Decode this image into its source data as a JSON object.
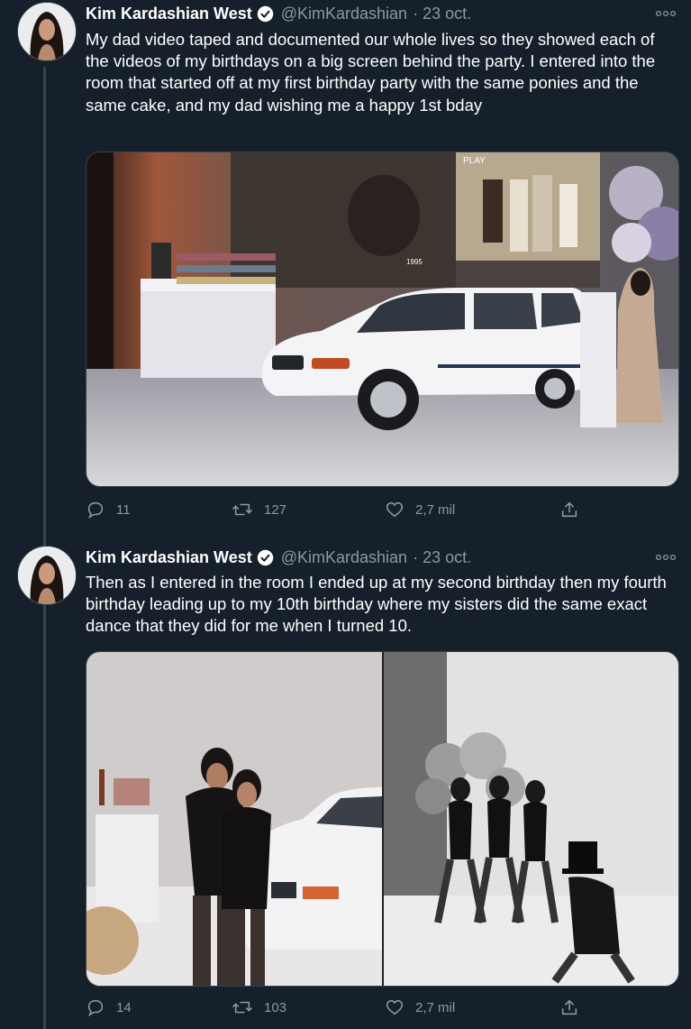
{
  "tweets": [
    {
      "author": {
        "name": "Kim Kardashian West",
        "handle": "@KimKardashian",
        "date": "· 23 oct."
      },
      "text": "My dad video taped and documented our whole lives so they showed each of the videos of my birthdays on a big screen behind the party. I entered into the room that started off at my first birthday party with the same ponies and the same cake, and my dad wishing me a happy 1st bday",
      "media": {
        "projection_label": "PLAY",
        "video_year": "1995"
      },
      "actions": {
        "replies": "11",
        "retweets": "127",
        "likes": "2,7 mil"
      }
    },
    {
      "author": {
        "name": "Kim Kardashian West",
        "handle": "@KimKardashian",
        "date": "· 23 oct."
      },
      "text": "Then as I entered in the room I ended up at my second birthday then my fourth birthday leading up to my 10th birthday where my sisters did the same exact dance that they did for me when I turned 10.",
      "actions": {
        "replies": "14",
        "retweets": "103",
        "likes": "2,7 mil"
      }
    }
  ],
  "colors": {
    "background": "#15202b",
    "muted": "#8899a6",
    "verified": "#1da1f2",
    "divider": "#38444d"
  },
  "icons": [
    "verified-badge-icon",
    "more-options-icon",
    "reply-icon",
    "retweet-icon",
    "like-icon",
    "share-icon"
  ]
}
